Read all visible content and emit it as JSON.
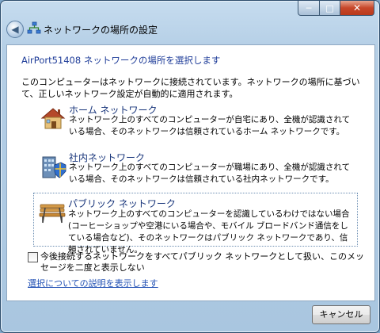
{
  "window": {
    "title": "ネットワークの場所の設定",
    "controls": {
      "minimize": "─",
      "maximize": "□",
      "close": "✕"
    }
  },
  "main": {
    "heading": "AirPort51408 ネットワークの場所を選択します",
    "description": "このコンピューターはネットワークに接続されています。ネットワークの場所に基づいて、正しいネットワーク設定が自動的に適用されます。",
    "options": [
      {
        "title": "ホーム ネットワーク",
        "body": "ネットワーク上のすべてのコンピューターが自宅にあり、全機が認識されている場合、そのネットワークは信頼されているホーム ネットワークです。",
        "icon": "house-icon"
      },
      {
        "title": "社内ネットワーク",
        "body": "ネットワーク上のすべてのコンピューターが職場にあり、全機が認識されている場合、そのネットワークは信頼されている社内ネットワークです。",
        "icon": "office-network-icon"
      },
      {
        "title": "パブリック ネットワーク",
        "body": "ネットワーク上のすべてのコンピューターを認識しているわけではない場合 (コーヒーショップや空港にいる場合や、モバイル ブロードバンド通信をしている場合など)、そのネットワークはパブリック ネットワークであり、信頼されていません。",
        "icon": "park-bench-icon",
        "selected": true
      }
    ],
    "checkbox_label": "今後接続するネットワークをすべてパブリック ネットワークとして扱い、このメッセージを二度と表示しない",
    "checkbox_checked": false,
    "help_link": "選択についての説明を表示します"
  },
  "footer": {
    "cancel_label": "キャンセル"
  }
}
